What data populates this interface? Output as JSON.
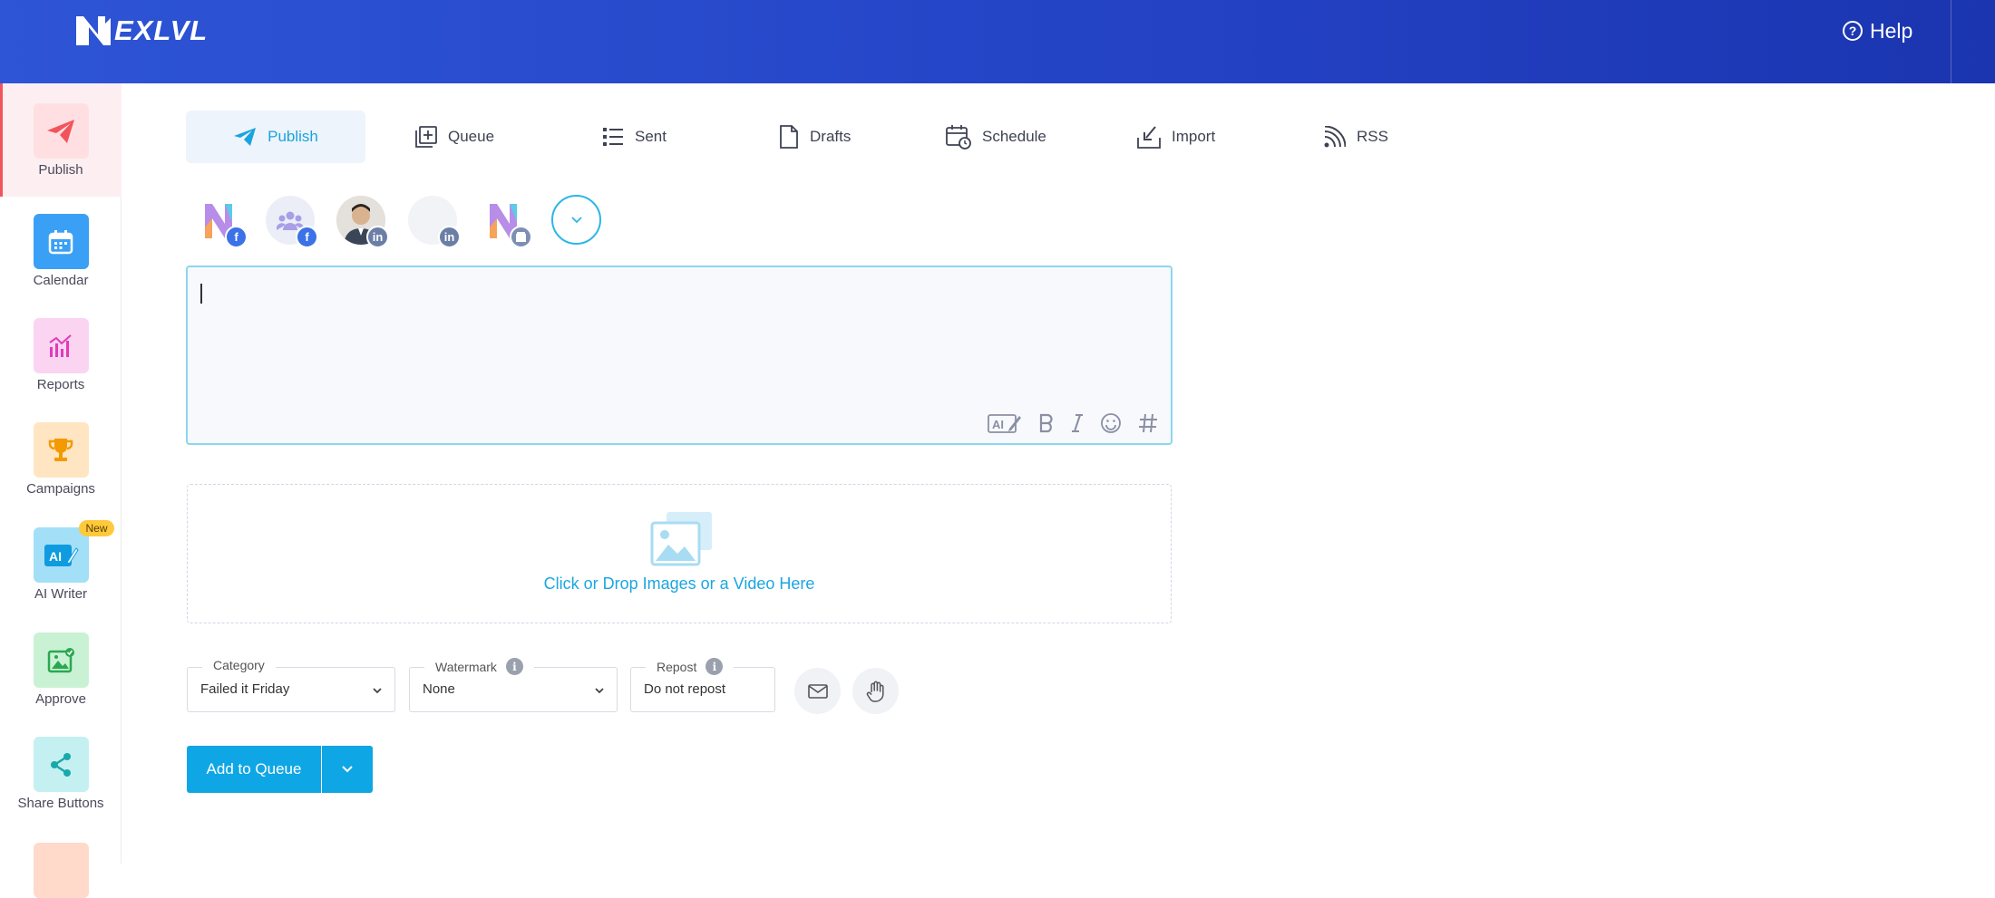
{
  "header": {
    "logo_text": "EXLVL",
    "help_label": "Help",
    "help_icon": "question-circle-icon"
  },
  "sidebar": {
    "items": [
      {
        "label": "Publish",
        "icon": "paper-plane-icon",
        "color": "#f2545b",
        "bg": "#ffdfe2",
        "active": true
      },
      {
        "label": "Calendar",
        "icon": "calendar-icon",
        "color": "#ffffff",
        "bg": "#3aa0f5"
      },
      {
        "label": "Reports",
        "icon": "bar-chart-icon",
        "color": "#e03cb8",
        "bg": "#fbd4f2"
      },
      {
        "label": "Campaigns",
        "icon": "trophy-icon",
        "color": "#f29a00",
        "bg": "#ffe5c2"
      },
      {
        "label": "AI Writer",
        "icon": "ai-writer-icon",
        "color": "#ffffff",
        "bg": "#a3dff7",
        "badge": "New"
      },
      {
        "label": "Approve",
        "icon": "image-check-icon",
        "color": "#2aa84f",
        "bg": "#c9f2d4"
      },
      {
        "label": "Share Buttons",
        "icon": "share-icon",
        "color": "#1aa8a8",
        "bg": "#c5f0f2"
      }
    ]
  },
  "tabs": [
    {
      "label": "Publish",
      "icon": "paper-plane-icon",
      "active": true
    },
    {
      "label": "Queue",
      "icon": "queue-add-icon"
    },
    {
      "label": "Sent",
      "icon": "list-icon"
    },
    {
      "label": "Drafts",
      "icon": "file-icon"
    },
    {
      "label": "Schedule",
      "icon": "calendar-clock-icon"
    },
    {
      "label": "Import",
      "icon": "import-icon"
    },
    {
      "label": "RSS",
      "icon": "rss-icon"
    }
  ],
  "accounts": [
    {
      "avatar": "nexlvl-logo",
      "network": "facebook"
    },
    {
      "avatar": "group-icon",
      "network": "facebook"
    },
    {
      "avatar": "person-photo",
      "network": "linkedin"
    },
    {
      "avatar": "blank",
      "network": "linkedin"
    },
    {
      "avatar": "nexlvl-logo",
      "network": "google-business"
    }
  ],
  "composer": {
    "value": "",
    "tools": [
      "ai-write-icon",
      "bold-icon",
      "italic-icon",
      "emoji-icon",
      "hashtag-icon"
    ]
  },
  "dropzone": {
    "text": "Click or Drop Images or a Video Here",
    "icon": "images-icon"
  },
  "fields": {
    "category": {
      "label": "Category",
      "value": "Failed it Friday"
    },
    "watermark": {
      "label": "Watermark",
      "value": "None"
    },
    "repost": {
      "label": "Repost",
      "value": "Do not repost"
    }
  },
  "actions": {
    "add_to_queue": "Add to Queue"
  },
  "colors": {
    "header": "#2747cc",
    "accent": "#0ea6e5",
    "active_red": "#f2545b"
  }
}
